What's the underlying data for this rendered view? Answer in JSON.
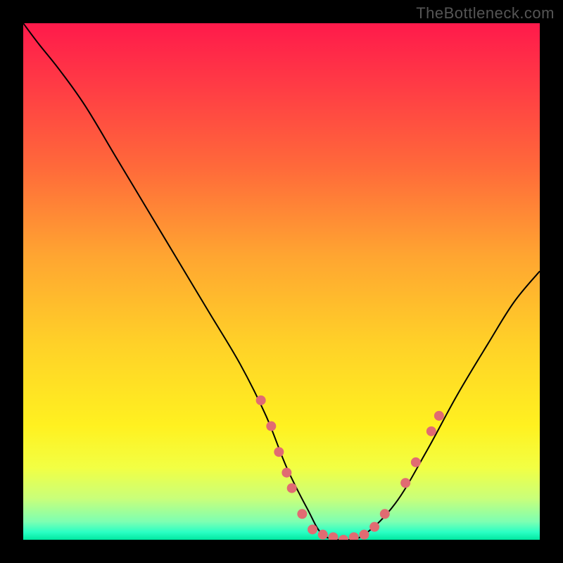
{
  "watermark": "TheBottleneck.com",
  "chart_data": {
    "type": "line",
    "title": "",
    "xlabel": "",
    "ylabel": "",
    "xlim": [
      0,
      100
    ],
    "ylim": [
      0,
      100
    ],
    "grid": false,
    "legend": false,
    "background_gradient_stops": [
      {
        "pos": 0.0,
        "color": "#ff1a4b"
      },
      {
        "pos": 0.12,
        "color": "#ff3b45"
      },
      {
        "pos": 0.28,
        "color": "#ff6a3a"
      },
      {
        "pos": 0.45,
        "color": "#ffa531"
      },
      {
        "pos": 0.62,
        "color": "#ffd128"
      },
      {
        "pos": 0.78,
        "color": "#fff120"
      },
      {
        "pos": 0.86,
        "color": "#f2ff43"
      },
      {
        "pos": 0.92,
        "color": "#c9ff7a"
      },
      {
        "pos": 0.965,
        "color": "#7dffb2"
      },
      {
        "pos": 0.985,
        "color": "#2bffc4"
      },
      {
        "pos": 1.0,
        "color": "#00e8a0"
      }
    ],
    "series": [
      {
        "name": "bottleneck-curve",
        "x": [
          0,
          3,
          7,
          12,
          18,
          24,
          30,
          36,
          42,
          47,
          51,
          55,
          58,
          62,
          66,
          72,
          78,
          84,
          90,
          95,
          100
        ],
        "y": [
          100,
          96,
          91,
          84,
          74,
          64,
          54,
          44,
          34,
          24,
          14,
          6,
          1,
          0,
          1,
          7,
          17,
          28,
          38,
          46,
          52
        ],
        "color": "#000000",
        "linewidth": 2
      }
    ],
    "markers": {
      "name": "highlight-dots",
      "color": "#e16b72",
      "radius": 7,
      "points": [
        {
          "x": 46,
          "y": 27
        },
        {
          "x": 48,
          "y": 22
        },
        {
          "x": 49.5,
          "y": 17
        },
        {
          "x": 51,
          "y": 13
        },
        {
          "x": 52,
          "y": 10
        },
        {
          "x": 54,
          "y": 5
        },
        {
          "x": 56,
          "y": 2
        },
        {
          "x": 58,
          "y": 1
        },
        {
          "x": 60,
          "y": 0.5
        },
        {
          "x": 62,
          "y": 0
        },
        {
          "x": 64,
          "y": 0.5
        },
        {
          "x": 66,
          "y": 1
        },
        {
          "x": 68,
          "y": 2.5
        },
        {
          "x": 70,
          "y": 5
        },
        {
          "x": 74,
          "y": 11
        },
        {
          "x": 76,
          "y": 15
        },
        {
          "x": 79,
          "y": 21
        },
        {
          "x": 80.5,
          "y": 24
        }
      ]
    }
  }
}
